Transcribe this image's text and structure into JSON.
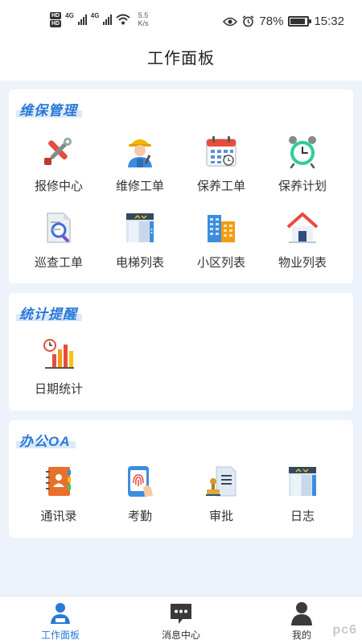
{
  "status_bar": {
    "network_speed_value": "5.5",
    "network_speed_unit": "K/s",
    "battery_percent": "78%",
    "time": "15:32",
    "network_type": "4G"
  },
  "header": {
    "title": "工作面板"
  },
  "sections": [
    {
      "title": "维保管理",
      "items": [
        {
          "label": "报修中心",
          "icon": "tools-icon"
        },
        {
          "label": "维修工单",
          "icon": "worker-icon"
        },
        {
          "label": "保养工单",
          "icon": "calendar-icon"
        },
        {
          "label": "保养计划",
          "icon": "alarm-clock-icon"
        },
        {
          "label": "巡查工单",
          "icon": "document-search-icon"
        },
        {
          "label": "电梯列表",
          "icon": "elevator-icon"
        },
        {
          "label": "小区列表",
          "icon": "buildings-icon"
        },
        {
          "label": "物业列表",
          "icon": "house-icon"
        }
      ]
    },
    {
      "title": "统计提醒",
      "items": [
        {
          "label": "日期统计",
          "icon": "bar-chart-clock-icon"
        }
      ]
    },
    {
      "title": "办公OA",
      "items": [
        {
          "label": "通讯录",
          "icon": "contacts-book-icon"
        },
        {
          "label": "考勤",
          "icon": "fingerprint-icon"
        },
        {
          "label": "审批",
          "icon": "stamp-document-icon"
        },
        {
          "label": "日志",
          "icon": "log-panel-icon"
        }
      ]
    }
  ],
  "bottom_nav": [
    {
      "label": "工作面板",
      "icon": "dashboard-user-icon",
      "active": true
    },
    {
      "label": "消息中心",
      "icon": "chat-bubble-icon",
      "active": false
    },
    {
      "label": "我的",
      "icon": "person-icon",
      "active": false
    }
  ],
  "watermark": "pc6",
  "colors": {
    "accent": "#2979d6",
    "background": "#eef3fb"
  }
}
